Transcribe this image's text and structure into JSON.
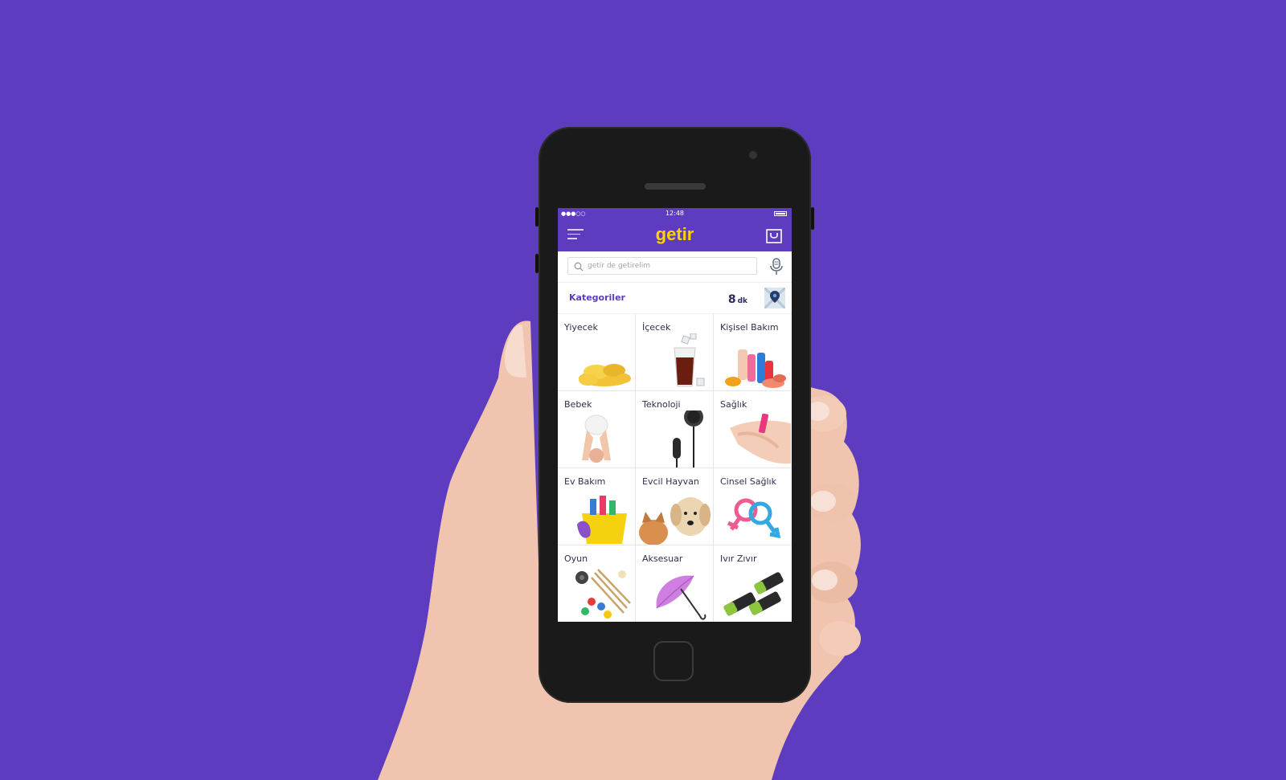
{
  "status_bar": {
    "signal": "●●●○○",
    "time": "12:48"
  },
  "header": {
    "logo": "getir"
  },
  "search": {
    "placeholder": "getir de getirelim"
  },
  "categories_bar": {
    "title": "Kategoriler",
    "eta_value": "8",
    "eta_unit": "dk"
  },
  "colors": {
    "brand": "#5d3cbf",
    "logo": "#ffd300"
  },
  "categories": [
    {
      "label": "Yiyecek"
    },
    {
      "label": "İçecek"
    },
    {
      "label": "Kişisel Bakım"
    },
    {
      "label": "Bebek"
    },
    {
      "label": "Teknoloji"
    },
    {
      "label": "Sağlık"
    },
    {
      "label": "Ev Bakım"
    },
    {
      "label": "Evcil Hayvan"
    },
    {
      "label": "Cinsel Sağlık"
    },
    {
      "label": "Oyun"
    },
    {
      "label": "Aksesuar"
    },
    {
      "label": "Ivır Zıvır"
    }
  ]
}
